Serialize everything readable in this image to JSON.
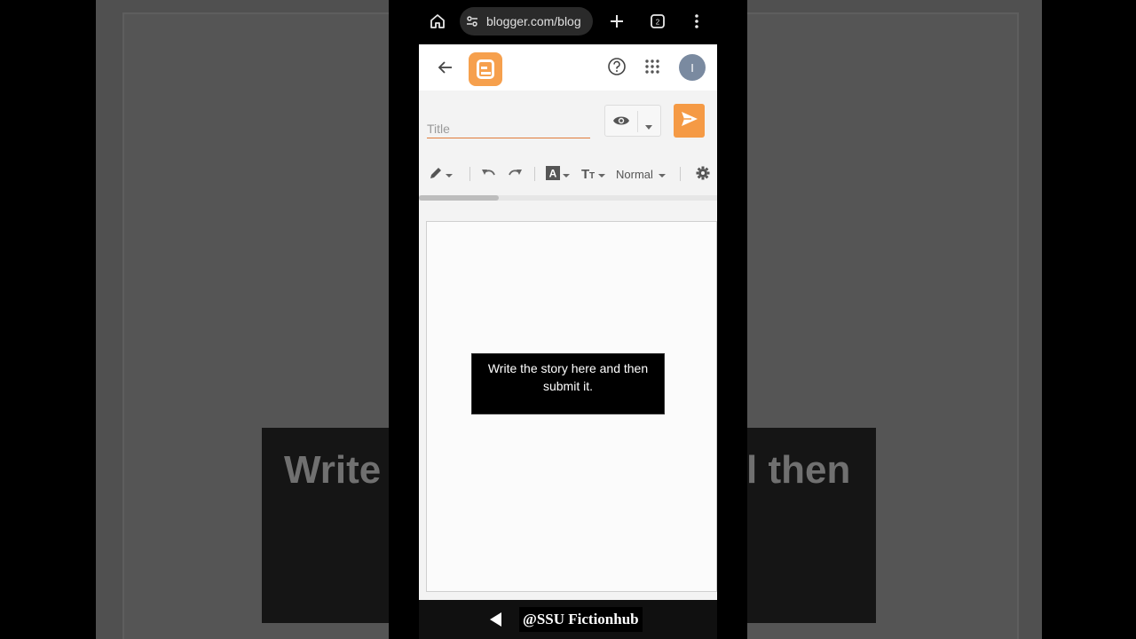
{
  "browser": {
    "url": "blogger.com/blog",
    "home_icon": "home-icon",
    "site_info_icon": "site-settings-icon",
    "new_tab_icon": "plus-icon",
    "tabs_icon": "tab-switcher-icon",
    "menu_icon": "more-vert-icon"
  },
  "header": {
    "back_icon": "arrow-back-icon",
    "logo": "blogger-logo",
    "help_icon": "help-icon",
    "apps_icon": "apps-grid-icon",
    "avatar_initial": "I"
  },
  "post": {
    "title_placeholder": "Title",
    "preview_icon": "eye-icon",
    "publish_icon": "send-icon"
  },
  "toolbar": {
    "format_label": "Normal"
  },
  "editor": {
    "tooltip_text": "Write the story here and then submit it."
  },
  "background": {
    "left_text": "Write",
    "right_text": "l then"
  },
  "watermark": "@SSU Fictionhub",
  "colors": {
    "blogger_orange": "#f59a45",
    "title_underline": "#e07a3a"
  }
}
